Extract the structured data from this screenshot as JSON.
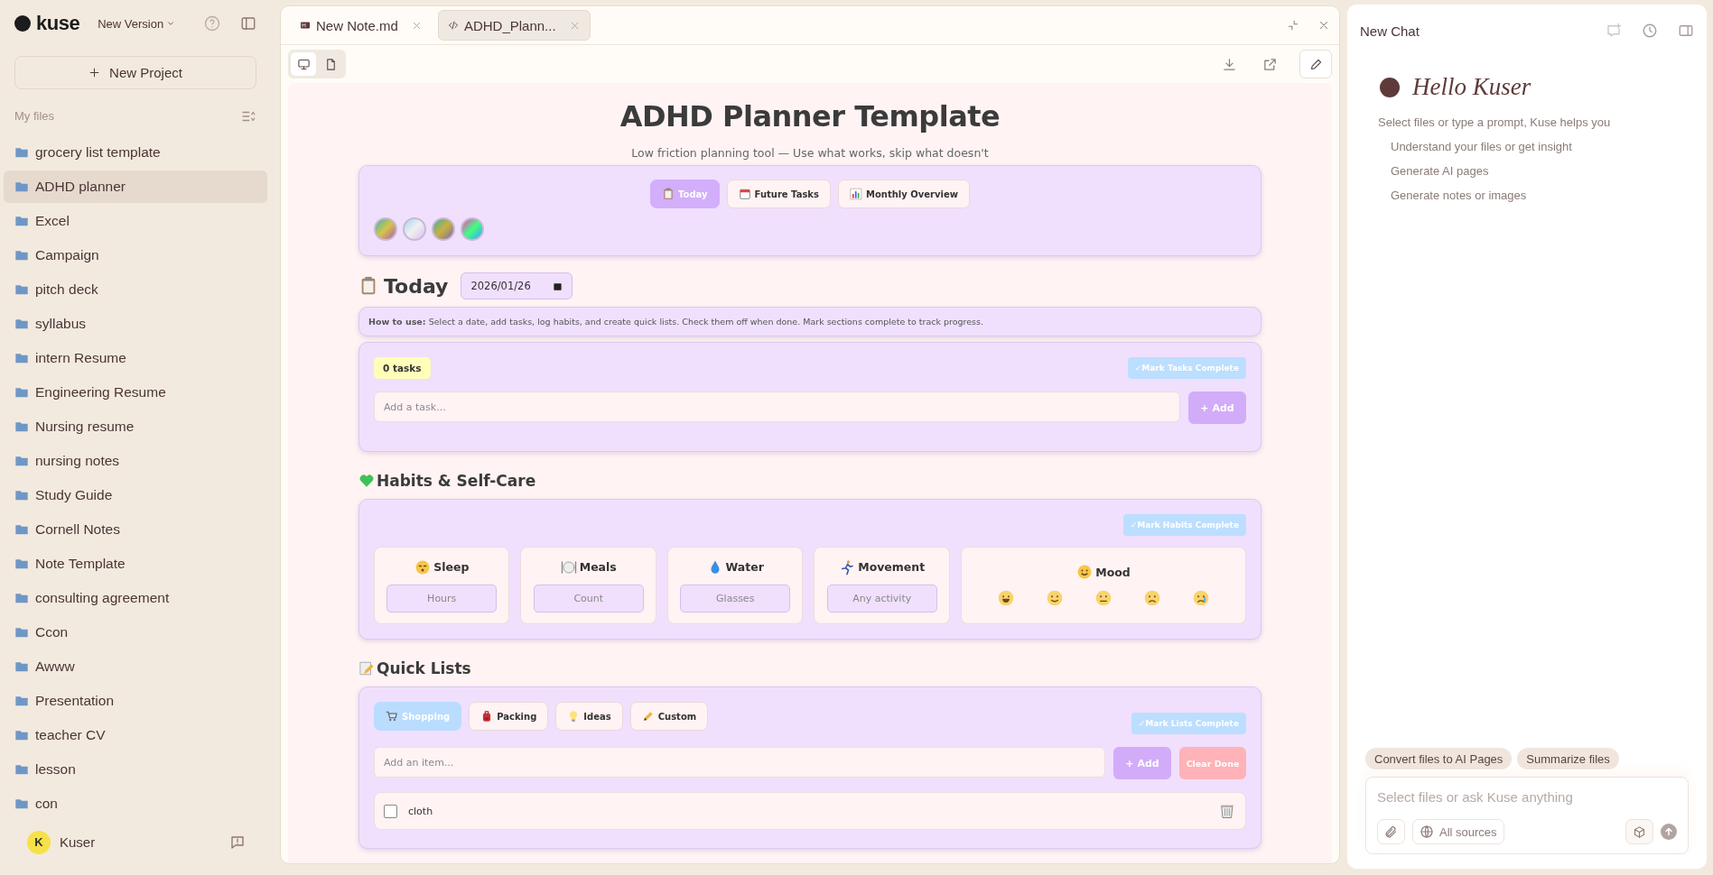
{
  "sidebar": {
    "brand": "kuse",
    "version": "New Version",
    "new_project": "New Project",
    "section": "My files",
    "files": [
      {
        "name": "grocery list template",
        "selected": false
      },
      {
        "name": "ADHD planner",
        "selected": true
      },
      {
        "name": "Excel",
        "selected": false
      },
      {
        "name": "Campaign",
        "selected": false
      },
      {
        "name": "pitch deck",
        "selected": false
      },
      {
        "name": "syllabus",
        "selected": false
      },
      {
        "name": "intern Resume",
        "selected": false
      },
      {
        "name": "Engineering Resume",
        "selected": false
      },
      {
        "name": "Nursing resume",
        "selected": false
      },
      {
        "name": "nursing notes",
        "selected": false
      },
      {
        "name": "Study Guide",
        "selected": false
      },
      {
        "name": "Cornell Notes",
        "selected": false
      },
      {
        "name": "Note Template",
        "selected": false
      },
      {
        "name": "consulting agreement",
        "selected": false
      },
      {
        "name": "Ccon",
        "selected": false
      },
      {
        "name": "Awww",
        "selected": false
      },
      {
        "name": "Presentation",
        "selected": false
      },
      {
        "name": "teacher CV",
        "selected": false
      },
      {
        "name": "lesson",
        "selected": false
      },
      {
        "name": "con",
        "selected": false
      }
    ],
    "user": {
      "initial": "K",
      "name": "Kuser"
    }
  },
  "editor": {
    "tabs": [
      {
        "title": "New Note.md",
        "selected": false
      },
      {
        "title": "ADHD_Plann...",
        "selected": true
      }
    ],
    "view_modes": [
      {
        "selected": true
      },
      {
        "selected": false
      }
    ]
  },
  "planner": {
    "title": "ADHD Planner Template",
    "subtitle": "Low friction planning tool — Use what works, skip what doesn't",
    "nav": [
      {
        "label": "Today",
        "selected": true
      },
      {
        "label": "Future Tasks",
        "selected": false
      },
      {
        "label": "Monthly Overview",
        "selected": false
      }
    ],
    "today": {
      "heading": "Today",
      "date": "2026/01/26"
    },
    "how_to": "**How to use:** Select a date, add tasks, log habits, and create quick lists. Check them off when done. Mark sections complete to track progress.",
    "tasks": {
      "count": "0 tasks",
      "complete": "✓Mark Tasks Complete",
      "placeholder": "Add a task...",
      "add": "+ Add"
    },
    "habits": {
      "heading": "Habits & Self-Care",
      "complete": "✓Mark Habits Complete",
      "items": [
        {
          "kind": "input",
          "label": "Sleep",
          "placeholder": "Hours"
        },
        {
          "kind": "input",
          "label": "Meals",
          "placeholder": "Count"
        },
        {
          "kind": "input",
          "label": "Water",
          "placeholder": "Glasses"
        },
        {
          "kind": "input",
          "label": "Movement",
          "placeholder": "Any activity"
        },
        {
          "kind": "mood",
          "label": "Mood"
        }
      ]
    },
    "lists": {
      "heading": "Quick Lists",
      "tabs": [
        {
          "label": "Shopping",
          "selected": true
        },
        {
          "label": "Packing",
          "selected": false
        },
        {
          "label": "Ideas",
          "selected": false
        },
        {
          "label": "Custom",
          "selected": false
        }
      ],
      "complete": "✓Mark Lists Complete",
      "placeholder": "Add an item...",
      "add": "+ Add",
      "clear": "Clear Done",
      "items": [
        {
          "text": "cloth",
          "checked": false
        }
      ]
    }
  },
  "chat": {
    "title": "New Chat",
    "greeting": "Hello Kuser",
    "intro": "Select files or type a prompt, Kuse helps you",
    "suggestions": [
      "Understand your files or get insight",
      "Generate AI pages",
      "Generate notes or images"
    ],
    "chips": [
      "Convert files to AI Pages",
      "Summarize files"
    ],
    "placeholder": "Select files or ask Kuse anything",
    "sources": "All sources"
  }
}
